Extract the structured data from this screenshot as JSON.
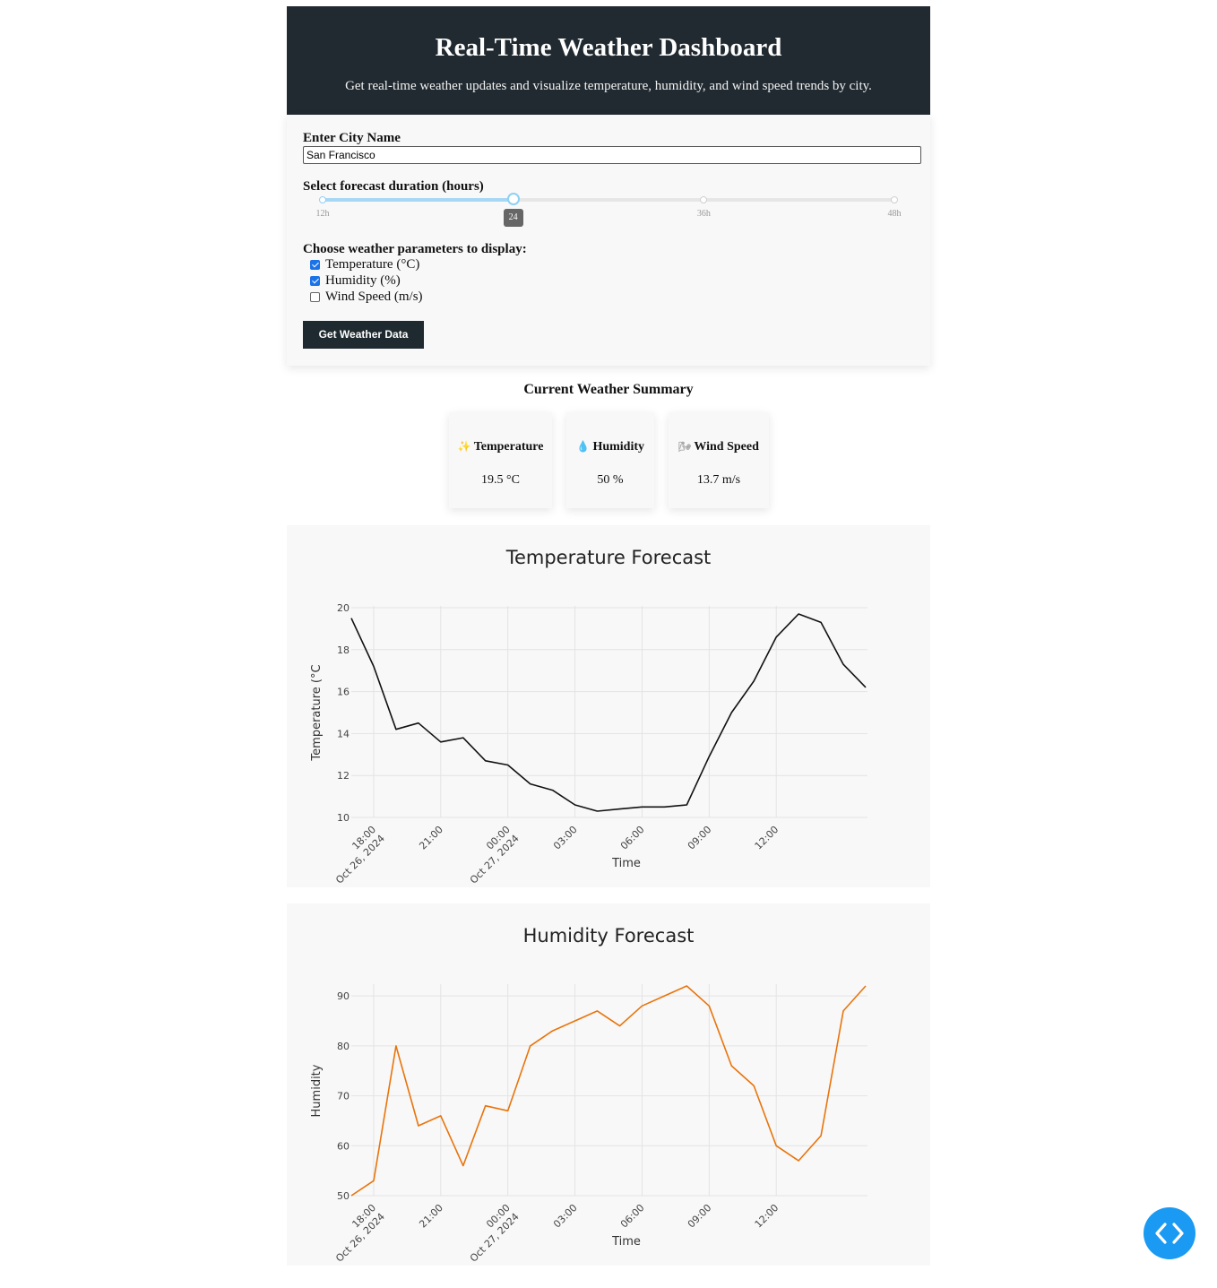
{
  "header": {
    "title": "Real-Time Weather Dashboard",
    "subtitle": "Get real-time weather updates and visualize temperature, humidity, and wind speed trends by city."
  },
  "controls": {
    "city_label": "Enter City Name",
    "city_value": "San Francisco",
    "duration_label": "Select forecast duration (hours)",
    "slider": {
      "min": 12,
      "max": 48,
      "value": 24,
      "marks": [
        "12h",
        "24",
        "36h",
        "48h"
      ],
      "tooltip": "24"
    },
    "params_label": "Choose weather parameters to display:",
    "params": [
      {
        "label": "Temperature (°C)",
        "checked": true
      },
      {
        "label": "Humidity (%)",
        "checked": true
      },
      {
        "label": "Wind Speed (m/s)",
        "checked": false
      }
    ],
    "button_label": "Get Weather Data"
  },
  "summary": {
    "title": "Current Weather Summary",
    "cards": [
      {
        "icon": "sparkles-icon",
        "glyph": "✨",
        "label": "Temperature",
        "value": "19.5 °C"
      },
      {
        "icon": "droplet-icon",
        "glyph": "💧",
        "label": "Humidity",
        "value": "50 %"
      },
      {
        "icon": "wind-icon",
        "glyph": "🌬",
        "label": "Wind Speed",
        "value": "13.7 m/s"
      }
    ]
  },
  "chart_data": [
    {
      "type": "line",
      "title": "Temperature Forecast",
      "xlabel": "Time",
      "ylabel": "Temperature (°C",
      "x": [
        "2024-10-26 17:00",
        "2024-10-26 18:00",
        "2024-10-26 19:00",
        "2024-10-26 20:00",
        "2024-10-26 21:00",
        "2024-10-26 22:00",
        "2024-10-26 23:00",
        "2024-10-27 00:00",
        "2024-10-27 01:00",
        "2024-10-27 02:00",
        "2024-10-27 03:00",
        "2024-10-27 04:00",
        "2024-10-27 05:00",
        "2024-10-27 06:00",
        "2024-10-27 07:00",
        "2024-10-27 08:00",
        "2024-10-27 09:00",
        "2024-10-27 10:00",
        "2024-10-27 11:00",
        "2024-10-27 12:00",
        "2024-10-27 13:00",
        "2024-10-27 14:00",
        "2024-10-27 15:00",
        "2024-10-27 16:00"
      ],
      "values": [
        19.5,
        17.2,
        14.2,
        14.5,
        13.6,
        13.8,
        12.7,
        12.5,
        11.6,
        11.3,
        10.6,
        10.3,
        10.4,
        10.5,
        10.5,
        10.6,
        12.9,
        15.0,
        16.5,
        18.6,
        19.7,
        19.3,
        17.3,
        16.2
      ],
      "x_ticks": [
        {
          "label": "18:00",
          "sub": "Oct 26, 2024"
        },
        {
          "label": "21:00",
          "sub": ""
        },
        {
          "label": "00:00",
          "sub": "Oct 27, 2024"
        },
        {
          "label": "03:00",
          "sub": ""
        },
        {
          "label": "06:00",
          "sub": ""
        },
        {
          "label": "09:00",
          "sub": ""
        },
        {
          "label": "12:00",
          "sub": ""
        }
      ],
      "y_ticks": [
        10,
        12,
        14,
        16,
        18,
        20
      ],
      "ylim": [
        10,
        20
      ],
      "color": "#111111",
      "grid": true
    },
    {
      "type": "line",
      "title": "Humidity Forecast",
      "xlabel": "Time",
      "ylabel": "Humidity",
      "x": [
        "2024-10-26 17:00",
        "2024-10-26 18:00",
        "2024-10-26 19:00",
        "2024-10-26 20:00",
        "2024-10-26 21:00",
        "2024-10-26 22:00",
        "2024-10-26 23:00",
        "2024-10-27 00:00",
        "2024-10-27 01:00",
        "2024-10-27 02:00",
        "2024-10-27 03:00",
        "2024-10-27 04:00",
        "2024-10-27 05:00",
        "2024-10-27 06:00",
        "2024-10-27 07:00",
        "2024-10-27 08:00",
        "2024-10-27 09:00",
        "2024-10-27 10:00",
        "2024-10-27 11:00",
        "2024-10-27 12:00",
        "2024-10-27 13:00",
        "2024-10-27 14:00",
        "2024-10-27 15:00",
        "2024-10-27 16:00"
      ],
      "values": [
        50,
        53,
        80,
        64,
        66,
        56,
        68,
        67,
        80,
        83,
        85,
        87,
        84,
        88,
        90,
        92,
        88,
        76,
        72,
        60,
        57,
        62,
        87,
        92
      ],
      "x_ticks": [
        {
          "label": "18:00",
          "sub": "Oct 26, 2024"
        },
        {
          "label": "21:00",
          "sub": ""
        },
        {
          "label": "00:00",
          "sub": "Oct 27, 2024"
        },
        {
          "label": "03:00",
          "sub": ""
        },
        {
          "label": "06:00",
          "sub": ""
        },
        {
          "label": "09:00",
          "sub": ""
        },
        {
          "label": "12:00",
          "sub": ""
        }
      ],
      "y_ticks": [
        50,
        60,
        70,
        80,
        90
      ],
      "ylim": [
        50,
        92
      ],
      "color": "#e8740c",
      "grid": true
    }
  ],
  "colors": {
    "header_bg": "#212a31",
    "button_bg": "#1f2a30",
    "panel_bg": "#f8f8f8",
    "fab_bg": "#1a9af2"
  },
  "fab": {
    "icon": "code-icon"
  }
}
